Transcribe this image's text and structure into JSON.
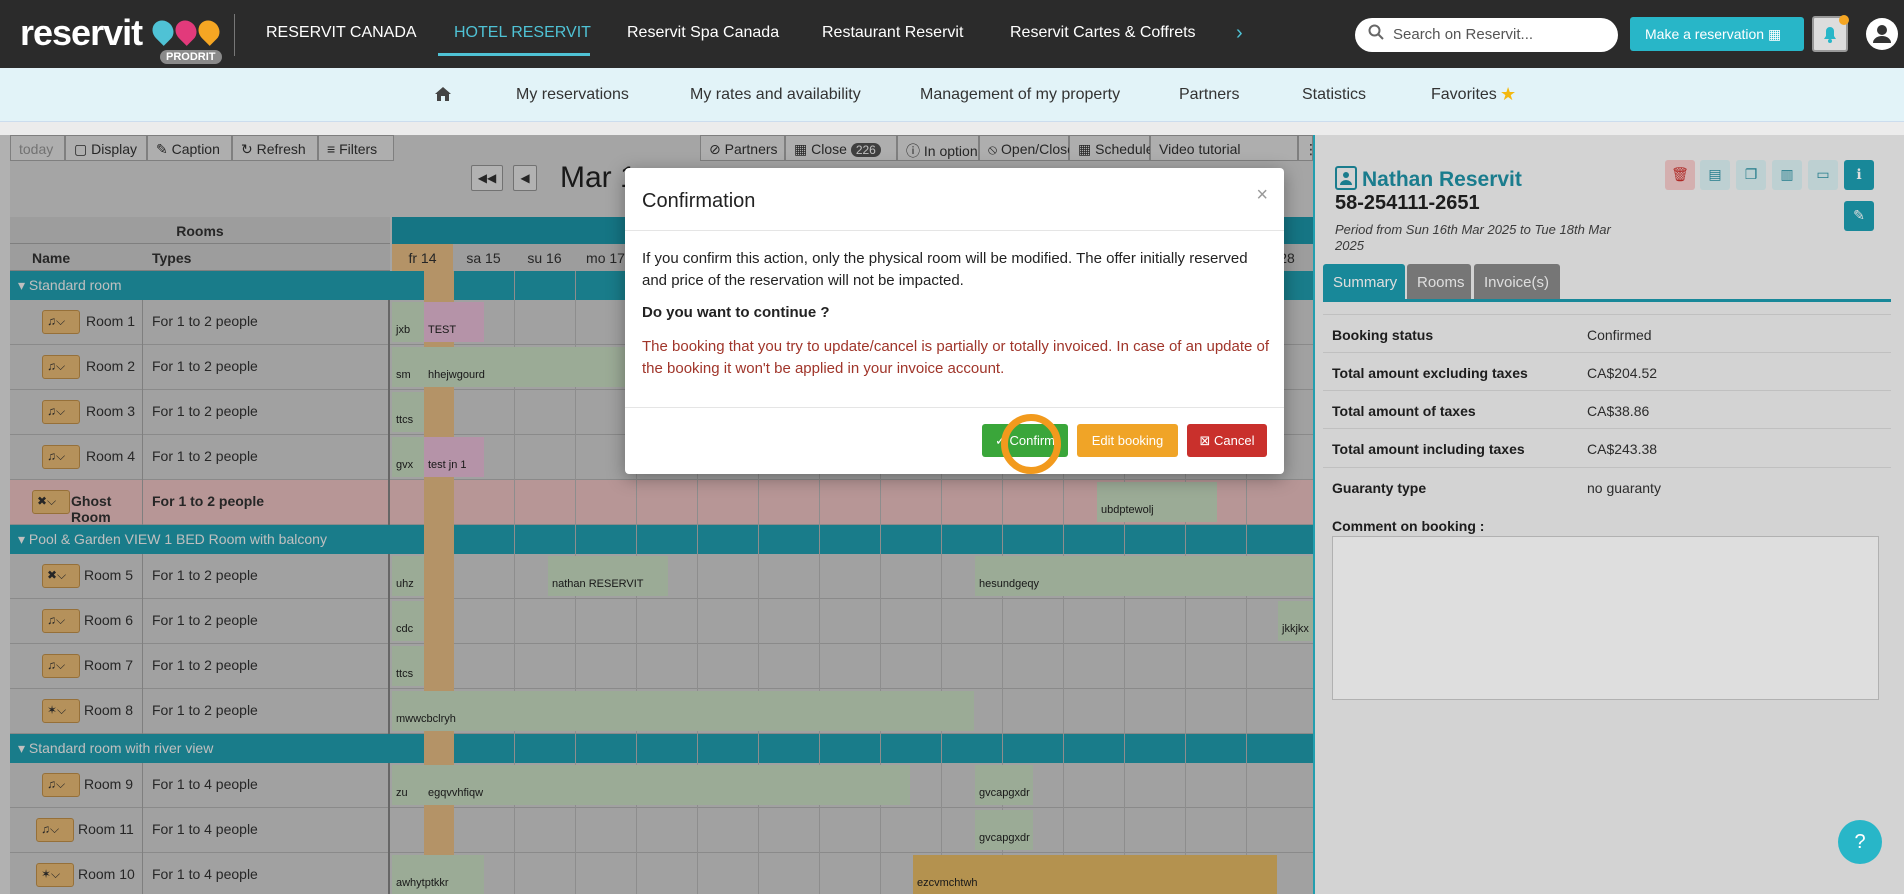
{
  "brand": {
    "logo_text": "reservit",
    "badge": "PRODRIT"
  },
  "top_nav": {
    "items": [
      "RESERVIT CANADA",
      "HOTEL RESERVIT",
      "Reservit Spa Canada",
      "Restaurant Reservit",
      "Reservit Cartes & Coffrets"
    ],
    "active_index": 1,
    "more_icon": "chevron-right-icon"
  },
  "search": {
    "placeholder": "Search on Reservit..."
  },
  "make_reservation": {
    "label": "Make a reservation"
  },
  "sub_nav": {
    "items": [
      "My reservations",
      "My rates and availability",
      "Management of my property",
      "Partners",
      "Statistics",
      "Favorites"
    ]
  },
  "toolbar": {
    "today": "today",
    "display": "Display",
    "caption": "Caption",
    "refresh": "Refresh",
    "filters": "Filters",
    "partners": "Partners",
    "close": "Close",
    "close_count": "226",
    "in_option": "In option",
    "open_close": "Open/Close",
    "schedule": "Schedule",
    "video_tutorial": "Video tutorial"
  },
  "calendar": {
    "date_title": "Mar 1",
    "rooms_header": "Rooms",
    "name_header": "Name",
    "types_header": "Types",
    "days": [
      "fr 14",
      "sa 15",
      "su 16",
      "mo 17"
    ],
    "last_day": "28",
    "sections": [
      {
        "label": "Standard room"
      },
      {
        "label": "Pool & Garden VIEW 1 BED Room with balcony"
      },
      {
        "label": "Standard room with river view"
      }
    ],
    "rooms": [
      {
        "name": "Room 1",
        "type": "For 1 to 2 people"
      },
      {
        "name": "Room 2",
        "type": "For 1 to 2 people"
      },
      {
        "name": "Room 3",
        "type": "For 1 to 2 people"
      },
      {
        "name": "Room 4",
        "type": "For 1 to 2 people"
      },
      {
        "name": "Ghost Room",
        "type": "For 1 to 2 people"
      },
      {
        "name": "Room 5",
        "type": "For 1 to 2 people"
      },
      {
        "name": "Room 6",
        "type": "For 1 to 2 people"
      },
      {
        "name": "Room 7",
        "type": "For 1 to 2 people"
      },
      {
        "name": "Room 8",
        "type": "For 1 to 2 people"
      },
      {
        "name": "Room 9",
        "type": "For 1 to 4 people"
      },
      {
        "name": "Room 11",
        "type": "For 1 to 4 people"
      },
      {
        "name": "Room 10",
        "type": "For 1 to 4 people"
      }
    ],
    "bookings": [
      "jxb",
      "TEST",
      "sm",
      "hhejwgourd",
      "ttcs",
      "gvx",
      "test jn 1",
      "ubdptewolj",
      "uhz",
      "nathan RESERVIT",
      "hesundgeqy",
      "cdc",
      "jkkjkx",
      "ttcs",
      "mwwcbclryh",
      "zu",
      "egqvvhfiqw",
      "gvcapgxdr",
      "gvcapgxdr",
      "awhytptkkr",
      "ezcvmchtwh"
    ]
  },
  "booking_panel": {
    "guest_name": "Nathan Reservit",
    "booking_number": "58-254111-2651",
    "period": "Period from Sun 16th Mar 2025 to Tue 18th Mar 2025",
    "tabs": [
      "Summary",
      "Rooms",
      "Invoice(s)"
    ],
    "rows": [
      {
        "label": "Booking status",
        "value": "Confirmed"
      },
      {
        "label": "Total amount excluding taxes",
        "value": "CA$204.52"
      },
      {
        "label": "Total amount of taxes",
        "value": "CA$38.86"
      },
      {
        "label": "Total amount including taxes",
        "value": "CA$243.38"
      },
      {
        "label": "Guaranty type",
        "value": "no guaranty"
      }
    ],
    "comment_label": "Comment on booking :"
  },
  "modal": {
    "title": "Confirmation",
    "close": "×",
    "body": "If you confirm this action, only the physical room will be modified. The offer initially reserved and price of the reservation will not be impacted.",
    "question": "Do you want to continue ?",
    "warning": "The booking that you try to update/cancel is partially or totally invoiced. In case of an update of the booking it won't be applied in your invoice account.",
    "confirm": "✓ Confirm",
    "edit": "Edit booking",
    "cancel": "⊠ Cancel"
  },
  "help": {
    "label": "?"
  },
  "colors": {
    "accent": "#28b6c8",
    "topbar": "#2b2b2b",
    "confirm": "#3aa63a",
    "edit": "#f0a427",
    "cancel": "#c9302c",
    "warning": "#a0352a"
  }
}
